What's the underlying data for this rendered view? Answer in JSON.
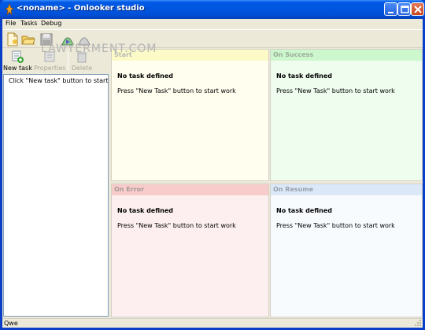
{
  "window": {
    "title": "<noname> - Onlooker studio"
  },
  "menu": {
    "file": "File",
    "tasks": "Tasks",
    "debug": "Debug"
  },
  "watermark": "LAWYERMENT.COM",
  "toolbar": {
    "new_task": "New task",
    "properties": "Properties",
    "delete": "Delete"
  },
  "tasklist": {
    "hint": "Click \"New task\" button to start"
  },
  "panels": {
    "start": {
      "header": "Start",
      "status": "No task defined",
      "prompt": "Press \"New Task\" button to start work"
    },
    "success": {
      "header": "On Success",
      "status": "No task defined",
      "prompt": "Press \"New Task\" button to start work"
    },
    "error": {
      "header": "On Error",
      "status": "No task defined",
      "prompt": "Press \"New Task\" button to start work"
    },
    "resume": {
      "header": "On Resume",
      "status": "No task defined",
      "prompt": "Press \"New Task\" button to start work"
    }
  },
  "statusbar": {
    "text": "Qwe"
  },
  "colors": {
    "title_bar": "#0056de",
    "start_header": "#fcfac7",
    "success_header": "#cdf7cc",
    "error_header": "#f8cccb",
    "resume_header": "#dbe8f8"
  }
}
